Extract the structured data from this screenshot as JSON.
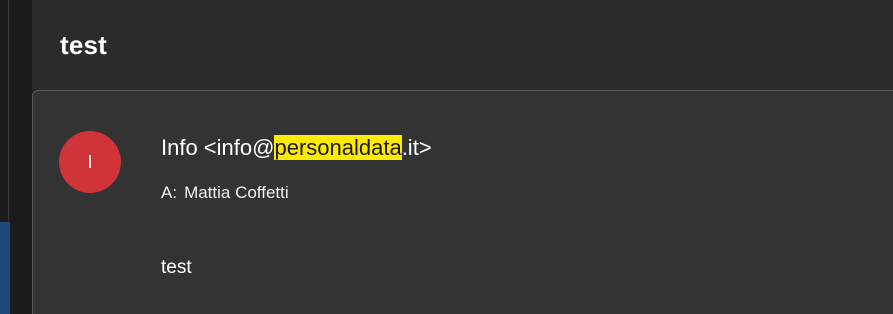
{
  "header": {
    "subject": "test"
  },
  "message": {
    "avatar_initial": "I",
    "sender": {
      "name_prefix": "Info <info@",
      "highlighted": "personaldata",
      "suffix": ".it>"
    },
    "recipient": {
      "label": "A:",
      "name": "Mattia Coffetti"
    },
    "body": "test"
  },
  "colors": {
    "avatar": "#d13438",
    "highlight": "#ffeb00",
    "card_bg": "#333333",
    "header_bg": "#2b2b2b"
  },
  "icons": {
    "avatar": "avatar-circle-initial"
  }
}
